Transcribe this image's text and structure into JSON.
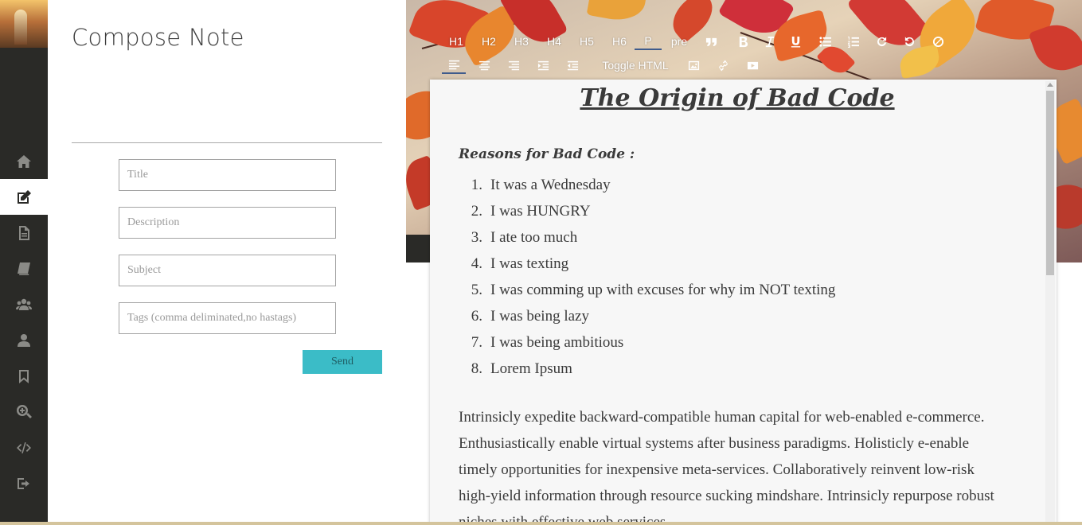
{
  "sidebar": {
    "items": [
      {
        "icon": "home-icon",
        "active": false
      },
      {
        "icon": "edit-icon",
        "active": true
      },
      {
        "icon": "document-icon",
        "active": false
      },
      {
        "icon": "book-icon",
        "active": false
      },
      {
        "icon": "users-icon",
        "active": false
      },
      {
        "icon": "user-icon",
        "active": false
      },
      {
        "icon": "bookmark-icon",
        "active": false
      },
      {
        "icon": "zoom-in-icon",
        "active": false
      },
      {
        "icon": "code-icon",
        "active": false
      },
      {
        "icon": "sign-out-icon",
        "active": false
      }
    ]
  },
  "compose": {
    "title": "Compose Note",
    "fields": {
      "title_placeholder": "Title",
      "description_placeholder": "Description",
      "subject_placeholder": "Subject",
      "tags_placeholder": "Tags (comma deliminated,no hastags)"
    },
    "send_label": "Send",
    "send_color": "#3bbcc7"
  },
  "toolbar": {
    "row1": [
      "H1",
      "H2",
      "H3",
      "H4",
      "H5",
      "H6",
      "P",
      "pre"
    ],
    "active": "P",
    "toggle_html": "Toggle HTML",
    "row1_icons": [
      "quote-icon",
      "bold-icon",
      "italic-icon",
      "underline-icon",
      "unordered-list-icon",
      "ordered-list-icon",
      "redo-icon",
      "undo-icon",
      "clear-format-icon"
    ],
    "row2_icons": [
      "align-left-icon",
      "align-center-icon",
      "align-right-icon",
      "indent-icon",
      "outdent-icon",
      "image-icon",
      "link-icon",
      "video-icon"
    ]
  },
  "document": {
    "title": "The Origin of Bad Code",
    "reasons_heading": "Reasons for Bad Code :",
    "reasons": [
      "It was a Wednesday",
      "I was HUNGRY",
      "I ate too much",
      "I was texting",
      "I was comming up with excuses for why im NOT texting",
      "I was being lazy",
      "I was being ambitious",
      "Lorem Ipsum"
    ],
    "paragraph": "Intrinsicly expedite backward-compatible human capital for web-enabled e-commerce. Enthusiastically enable virtual systems after business paradigms. Holisticly e-enable timely opportunities for inexpensive meta-services. Collaboratively reinvent low-risk high-yield information through resource sucking mindshare. Intrinsicly repurpose robust niches with effective web services."
  }
}
